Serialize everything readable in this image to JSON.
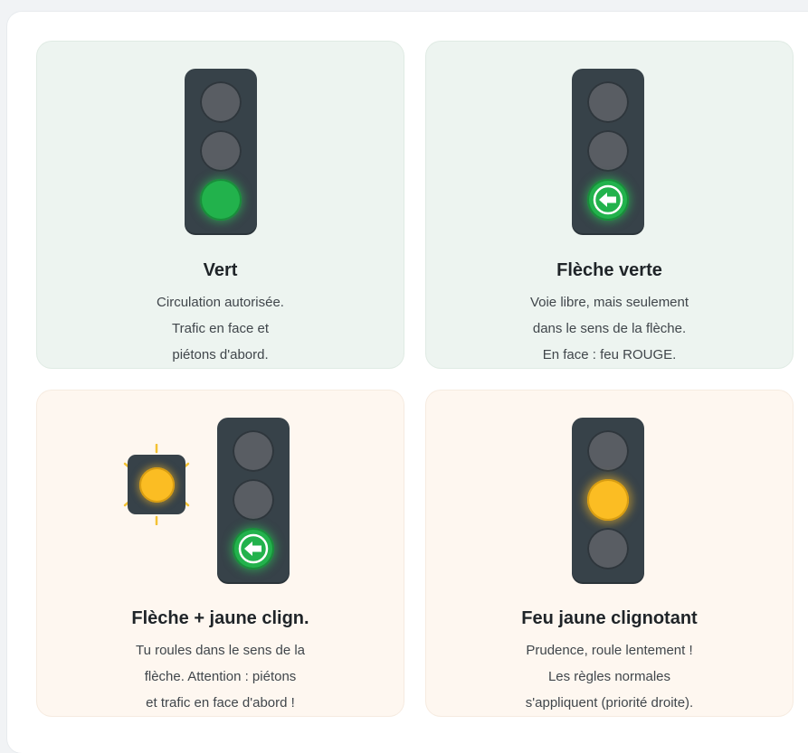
{
  "colors": {
    "green_card_bg": "#edf4f0",
    "amber_card_bg": "#fef7f0",
    "housing": "#374249",
    "lamp_off": "#595d63",
    "green_light": "#22b24c",
    "yellow_light": "#fbbd23"
  },
  "cards": [
    {
      "title": "Vert",
      "lines": [
        "Circulation autorisée.",
        "Trafic en face et",
        "piétons d'abord."
      ],
      "icons": [
        "traffic-light-icon",
        "green-light-icon"
      ]
    },
    {
      "title": "Flèche verte",
      "lines": [
        "Voie libre, mais seulement",
        "dans le sens de la flèche.",
        "En face : feu ROUGE."
      ],
      "icons": [
        "traffic-light-icon",
        "green-arrow-left-icon"
      ]
    },
    {
      "title": "Flèche + jaune clign.",
      "lines": [
        "Tu roules dans le sens de la",
        "flèche. Attention : piétons",
        "et trafic en face d'abord !"
      ],
      "icons": [
        "flashing-yellow-light-icon",
        "traffic-light-icon",
        "green-arrow-left-icon"
      ]
    },
    {
      "title": "Feu jaune clignotant",
      "lines": [
        "Prudence, roule lentement !",
        "Les règles normales",
        "s'appliquent (priorité droite)."
      ],
      "icons": [
        "traffic-light-icon",
        "yellow-light-icon"
      ]
    }
  ]
}
